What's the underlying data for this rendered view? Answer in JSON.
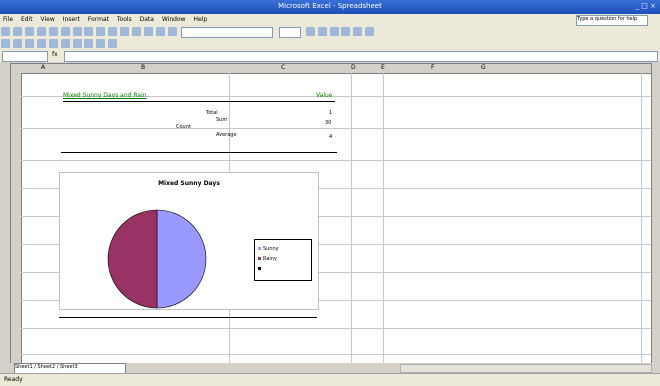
{
  "window": {
    "title": "Microsoft Excel - Spreadsheet",
    "controls": "_ □ ×"
  },
  "menu": {
    "items": [
      "File",
      "Edit",
      "View",
      "Insert",
      "Format",
      "Tools",
      "Data",
      "Window",
      "Help"
    ],
    "help_placeholder": "Type a question for help"
  },
  "formula_bar": {
    "fx": "fx"
  },
  "columns": [
    "A",
    "B",
    "C",
    "D",
    "E",
    "F",
    "G"
  ],
  "sheet": {
    "link_text": "Mixed Sunny Days and Rain",
    "link_value": "Value",
    "labels": [
      "Total",
      "Sum",
      "Count",
      "Average"
    ],
    "values": [
      "1",
      "30",
      "4"
    ]
  },
  "chart_data": {
    "type": "pie",
    "title": "Mixed Sunny Days",
    "categories": [
      "Sunny",
      "Rainy",
      ""
    ],
    "values": [
      50,
      50
    ],
    "colors": [
      "#9999ff",
      "#993366"
    ]
  },
  "tabs": {
    "sheet1": "Sheet1 / Sheet2 / Sheet3"
  },
  "status": {
    "text": "Ready"
  }
}
